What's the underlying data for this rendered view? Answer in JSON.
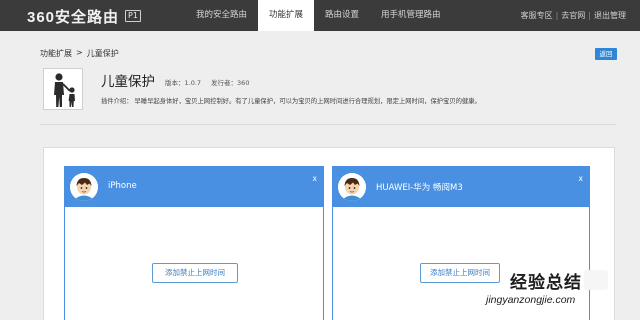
{
  "logo": {
    "text": "360安全路由",
    "badge": "P1"
  },
  "nav": [
    {
      "label": "我的安全路由",
      "active": false
    },
    {
      "label": "功能扩展",
      "active": true
    },
    {
      "label": "路由设置",
      "active": false
    },
    {
      "label": "用手机管理路由",
      "active": false
    }
  ],
  "links": {
    "support": "客服专区",
    "site": "去官网",
    "logout": "退出管理",
    "sep": "|"
  },
  "breadcrumb": {
    "parent": "功能扩展",
    "sep": ">",
    "current": "儿童保护"
  },
  "back_label": "返回",
  "app": {
    "title": "儿童保护",
    "version": "版本：1.0.7",
    "publisher": "发行者：360",
    "desc": "插件介绍：   早睡早起身体好，宝贝上网control好。有了儿童保护，可以为宝贝的上网时间进行合理规划，限定上网时间，保护宝贝的健康。"
  },
  "devices": [
    {
      "name": "iPhone",
      "close": "x",
      "add_label": "添加禁止上网时间"
    },
    {
      "name": "HUAWEI-华为 畅阅M3",
      "close": "x",
      "add_label": "添加禁止上网时间"
    }
  ],
  "watermark": {
    "title": "经验总结",
    "url": "jingyanzongjie.com"
  },
  "colors": {
    "topbar": "#3b3b3b",
    "accent": "#4a90e2",
    "back_button": "#2f86d6"
  }
}
